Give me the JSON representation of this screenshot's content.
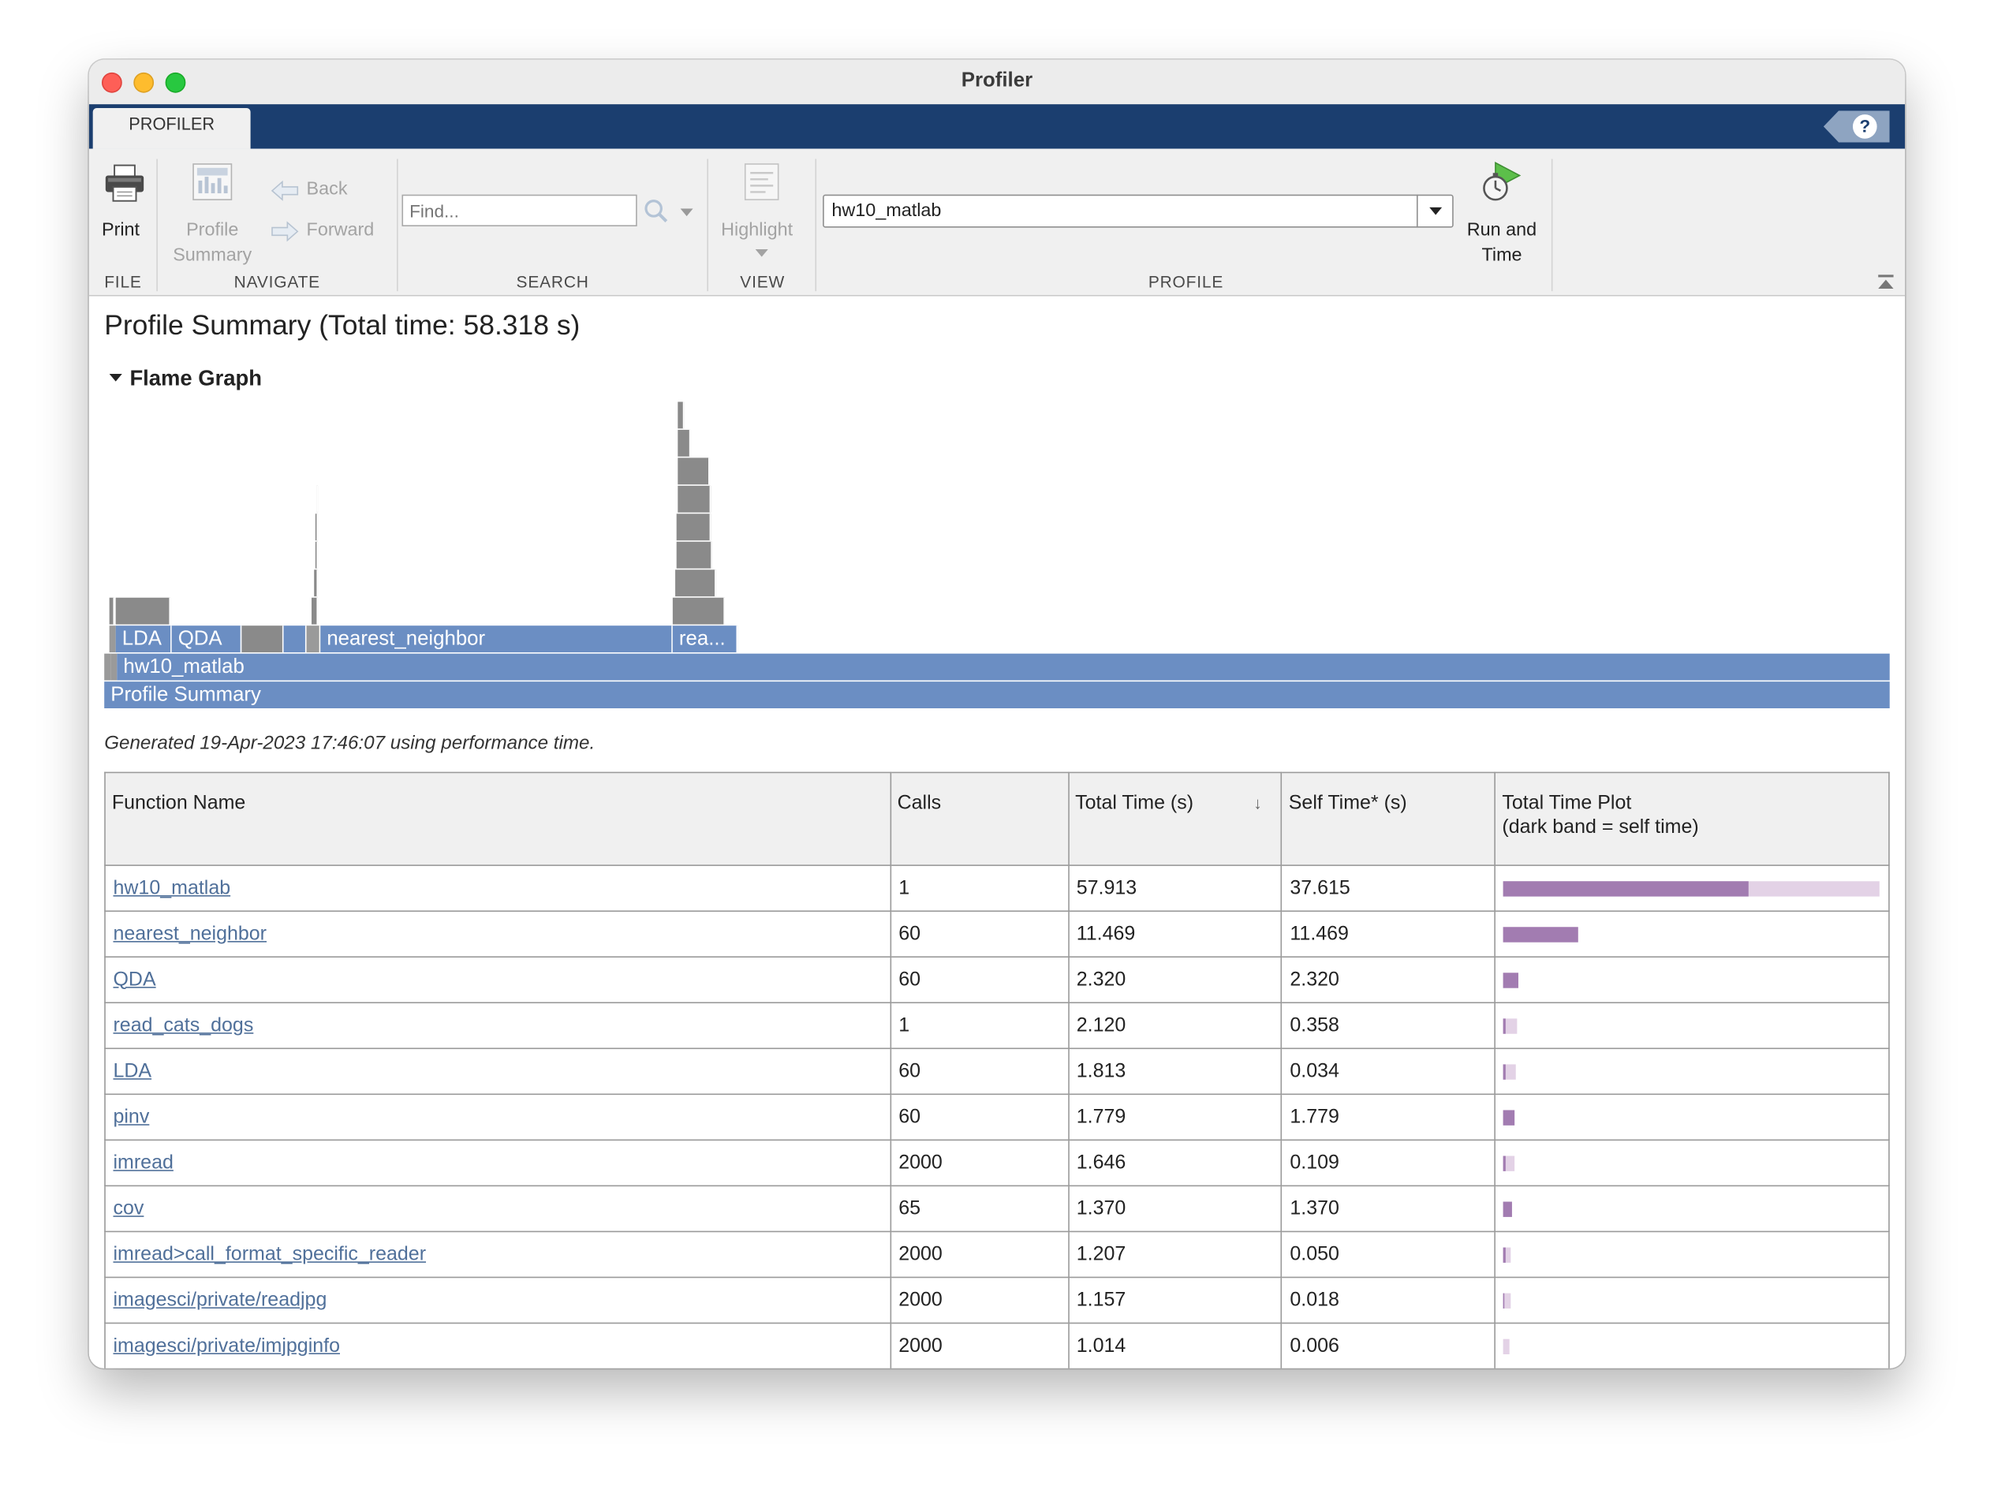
{
  "window": {
    "title": "Profiler"
  },
  "tabs": {
    "profiler": "PROFILER",
    "help": "?"
  },
  "toolstrip": {
    "file": {
      "print": "Print",
      "group": "FILE"
    },
    "navigate": {
      "profile_summary_1": "Profile",
      "profile_summary_2": "Summary",
      "back": "Back",
      "forward": "Forward",
      "group": "NAVIGATE"
    },
    "search": {
      "placeholder": "Find...",
      "group": "SEARCH"
    },
    "view": {
      "highlight": "Highlight",
      "group": "VIEW"
    },
    "profile": {
      "target": "hw10_matlab",
      "run_1": "Run and",
      "run_2": "Time",
      "group": "PROFILE"
    }
  },
  "content": {
    "title": "Profile Summary (Total time: 58.318 s)",
    "flame_header": "Flame Graph",
    "flame_labels": {
      "root": "Profile Summary",
      "main": "hw10_matlab",
      "lda": "LDA",
      "qda": "QDA",
      "nn": "nearest_neighbor",
      "read": "rea..."
    },
    "generated": "Generated 19-Apr-2023 17:46:07 using performance time."
  },
  "table": {
    "headers": {
      "function_name": "Function Name",
      "calls": "Calls",
      "total_time": "Total Time (s)",
      "self_time": "Self Time* (s)",
      "plot_1": "Total Time Plot",
      "plot_2": "(dark band = self time)"
    },
    "rows": [
      {
        "name": "hw10_matlab",
        "calls": "1",
        "total": "57.913",
        "self": "37.615"
      },
      {
        "name": "nearest_neighbor",
        "calls": "60",
        "total": "11.469",
        "self": "11.469"
      },
      {
        "name": "QDA",
        "calls": "60",
        "total": "2.320",
        "self": "2.320"
      },
      {
        "name": "read_cats_dogs",
        "calls": "1",
        "total": "2.120",
        "self": "0.358"
      },
      {
        "name": "LDA",
        "calls": "60",
        "total": "1.813",
        "self": "0.034"
      },
      {
        "name": "pinv",
        "calls": "60",
        "total": "1.779",
        "self": "1.779"
      },
      {
        "name": "imread",
        "calls": "2000",
        "total": "1.646",
        "self": "0.109"
      },
      {
        "name": "cov",
        "calls": "65",
        "total": "1.370",
        "self": "1.370"
      },
      {
        "name": "imread>call_format_specific_reader",
        "calls": "2000",
        "total": "1.207",
        "self": "0.050"
      },
      {
        "name": "imagesci/private/readjpg",
        "calls": "2000",
        "total": "1.157",
        "self": "0.018"
      },
      {
        "name": "imagesci/private/imjpginfo",
        "calls": "2000",
        "total": "1.014",
        "self": "0.006"
      }
    ]
  },
  "colors": {
    "accent": "#1b3e6f",
    "flame_blue": "#6b8ec3",
    "self_band": "#a27cb1",
    "total_band": "#e3d2e6",
    "link": "#50709a"
  }
}
